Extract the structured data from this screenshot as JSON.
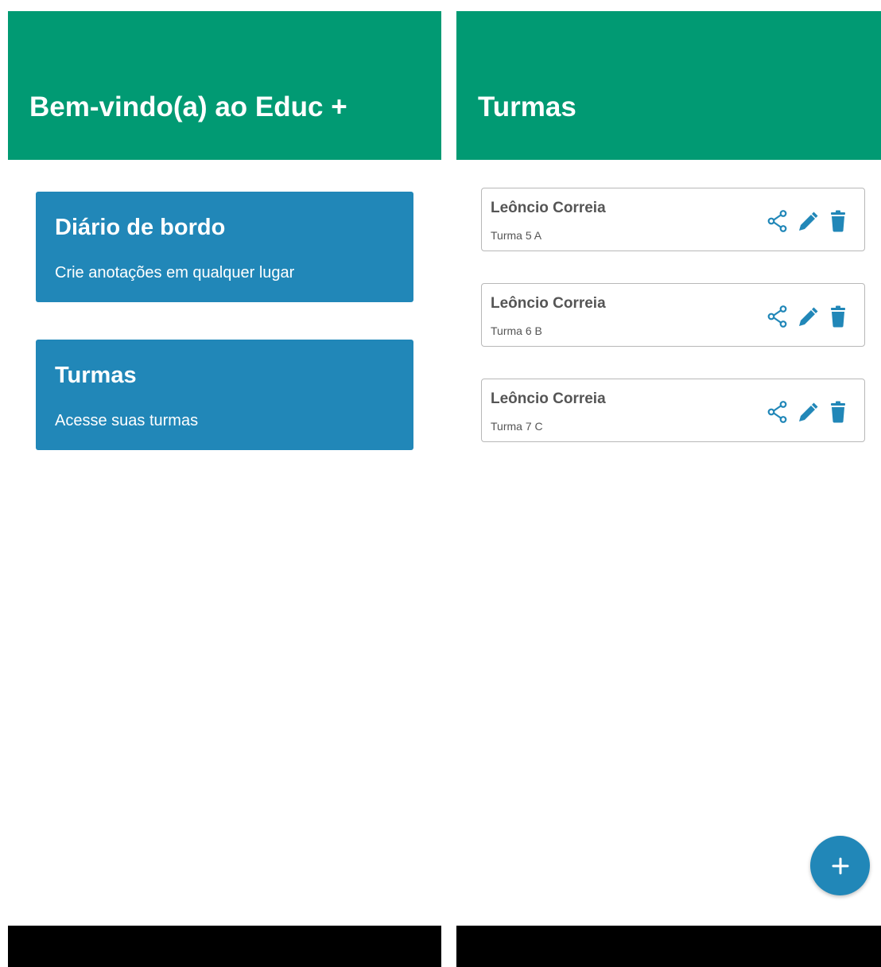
{
  "colors": {
    "header_green": "#019a73",
    "card_blue": "#2187b8",
    "icon_blue": "#2187b8",
    "nav_black": "#000000"
  },
  "home_screen": {
    "header": {
      "title": "Bem-vindo(a) ao Educ +"
    },
    "menu_cards": [
      {
        "title": "Diário de bordo",
        "subtitle": "Crie anotações em qualquer lugar"
      },
      {
        "title": "Turmas",
        "subtitle": "Acesse suas turmas"
      }
    ]
  },
  "classes_screen": {
    "header": {
      "title": "Turmas"
    },
    "classes": [
      {
        "teacher": "Leôncio Correia",
        "class_name": "Turma 5 A"
      },
      {
        "teacher": "Leôncio Correia",
        "class_name": "Turma 6 B"
      },
      {
        "teacher": "Leôncio Correia",
        "class_name": "Turma 7 C"
      }
    ],
    "card_actions": [
      "share-icon",
      "edit-icon",
      "delete-icon"
    ],
    "fab": {
      "icon": "plus-icon"
    }
  }
}
